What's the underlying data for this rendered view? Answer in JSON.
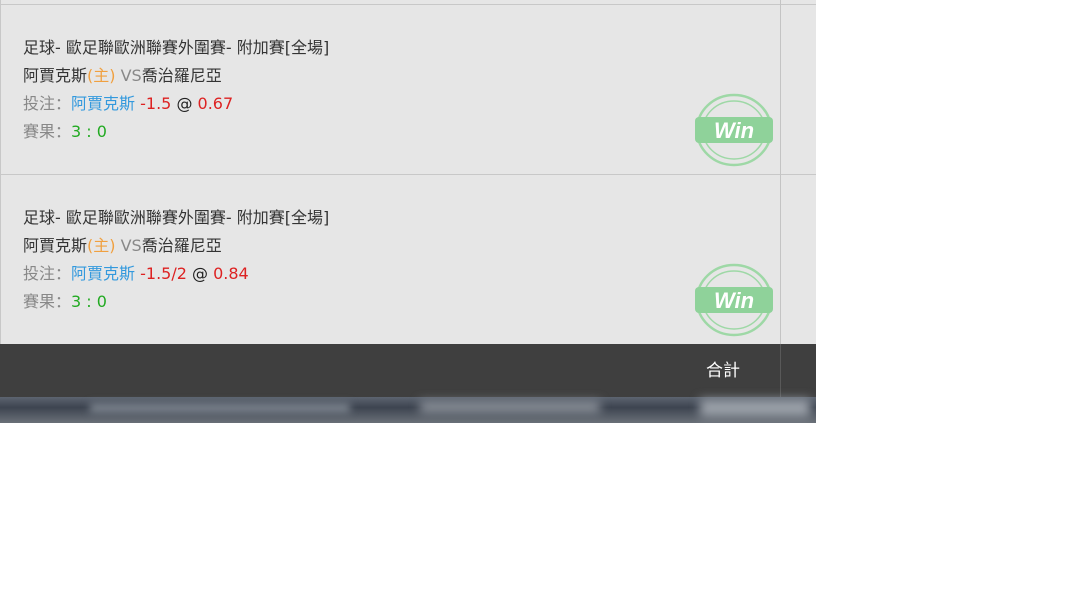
{
  "bets": [
    {
      "league": "足球- 歐足聯歐洲聯賽外圍賽- 附加賽[全場]",
      "home_team": "阿賈克斯",
      "home_mark": "(主)",
      "vs_text": " VS",
      "away_team": "喬治羅尼亞",
      "bet_label": "投注：",
      "bet_team": "阿賈克斯",
      "handicap": "-1.5",
      "at": "@",
      "odds": "0.67",
      "result_label": "賽果：",
      "score": "3 : 0",
      "stamp_text": "Win"
    },
    {
      "league": "足球- 歐足聯歐洲聯賽外圍賽- 附加賽[全場]",
      "home_team": "阿賈克斯",
      "home_mark": "(主)",
      "vs_text": " VS",
      "away_team": "喬治羅尼亞",
      "bet_label": "投注：",
      "bet_team": "阿賈克斯",
      "handicap": "-1.5/2",
      "at": "@",
      "odds": "0.84",
      "result_label": "賽果：",
      "score": "3 : 0",
      "stamp_text": "Win"
    }
  ],
  "footer": {
    "total_label": "合計"
  },
  "colors": {
    "panel_bg": "#e6e6e6",
    "footer_bg": "#3f3f3f",
    "home_mark": "#f0a040",
    "bet_team": "#3399dd",
    "odds_red": "#dd2222",
    "score_green": "#22aa22",
    "stamp_green": "#8fd29a"
  }
}
